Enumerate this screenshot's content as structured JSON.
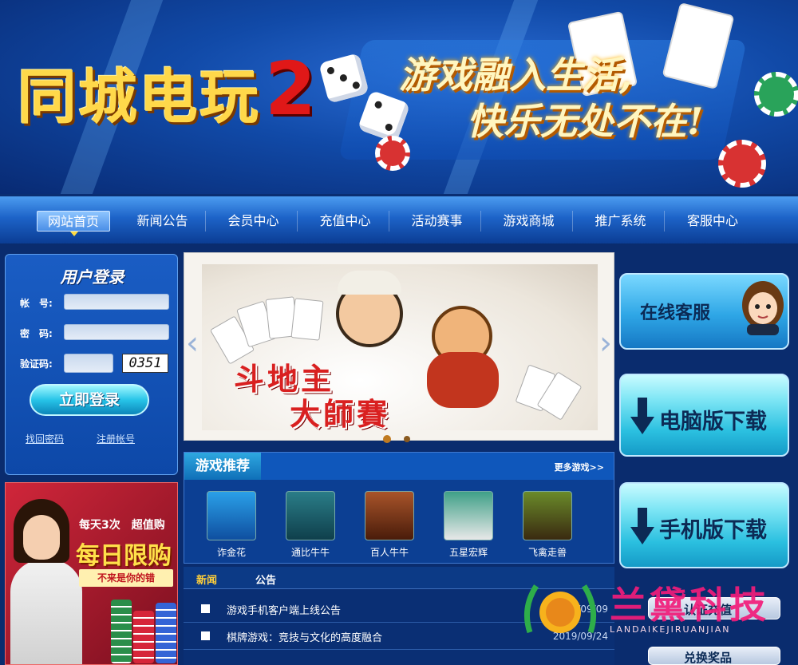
{
  "banner": {
    "logo": "同城电玩",
    "logo_number": "2",
    "slogan_line1": "游戏融入生活,",
    "slogan_line2": "快乐无处不在!"
  },
  "nav": {
    "items": [
      {
        "label": "网站首页",
        "active": true
      },
      {
        "label": "新闻公告"
      },
      {
        "label": "会员中心"
      },
      {
        "label": "充值中心"
      },
      {
        "label": "活动赛事"
      },
      {
        "label": "游戏商城"
      },
      {
        "label": "推广系统"
      },
      {
        "label": "客服中心"
      }
    ]
  },
  "login": {
    "title": "用户登录",
    "account_label": "帐　号:",
    "password_label": "密　码:",
    "captcha_label": "验证码:",
    "account_value": "",
    "password_value": "",
    "captcha_input_value": "",
    "captcha_image_text": "0351",
    "submit_label": "立即登录",
    "forgot_label": "找回密码",
    "register_label": "注册帐号"
  },
  "promo": {
    "top_text": "每天3次　超值购",
    "big_text": "每日限购",
    "ribbon_text": "不来是你的错"
  },
  "slider": {
    "title_line1": "斗地主",
    "title_line2": "大師賽",
    "prev_icon": "‹",
    "next_icon": "›"
  },
  "games": {
    "tab_label": "游戏推荐",
    "more_label": "更多游戏>>",
    "items": [
      {
        "label": "诈金花"
      },
      {
        "label": "通比牛牛"
      },
      {
        "label": "百人牛牛"
      },
      {
        "label": "五星宏辉"
      },
      {
        "label": "飞禽走兽"
      }
    ]
  },
  "news": {
    "tabs": [
      "新闻",
      "公告"
    ],
    "rows": [
      {
        "title": "游戏手机客户端上线公告",
        "date": "2019/09/09"
      },
      {
        "title": "棋牌游戏：竞技与文化的高度融合",
        "date": "2019/09/24"
      }
    ]
  },
  "right": {
    "service_label": "在线客服",
    "pc_download_label": "电脑版下载",
    "mobile_download_label": "手机版下载",
    "small_btn1_label": "认证充值",
    "small_btn2_label": "兑换奖品"
  },
  "watermark": {
    "text": "兰黛科技",
    "sub": "LANDAIKEJIRUANJIAN"
  },
  "colors": {
    "nav_gradient_top": "#4c9cf0",
    "nav_gradient_bottom": "#0b3d94",
    "page_bg": "#0a2c6e",
    "accent_gold": "#ffd84a",
    "watermark_pink": "#f21c7a"
  }
}
